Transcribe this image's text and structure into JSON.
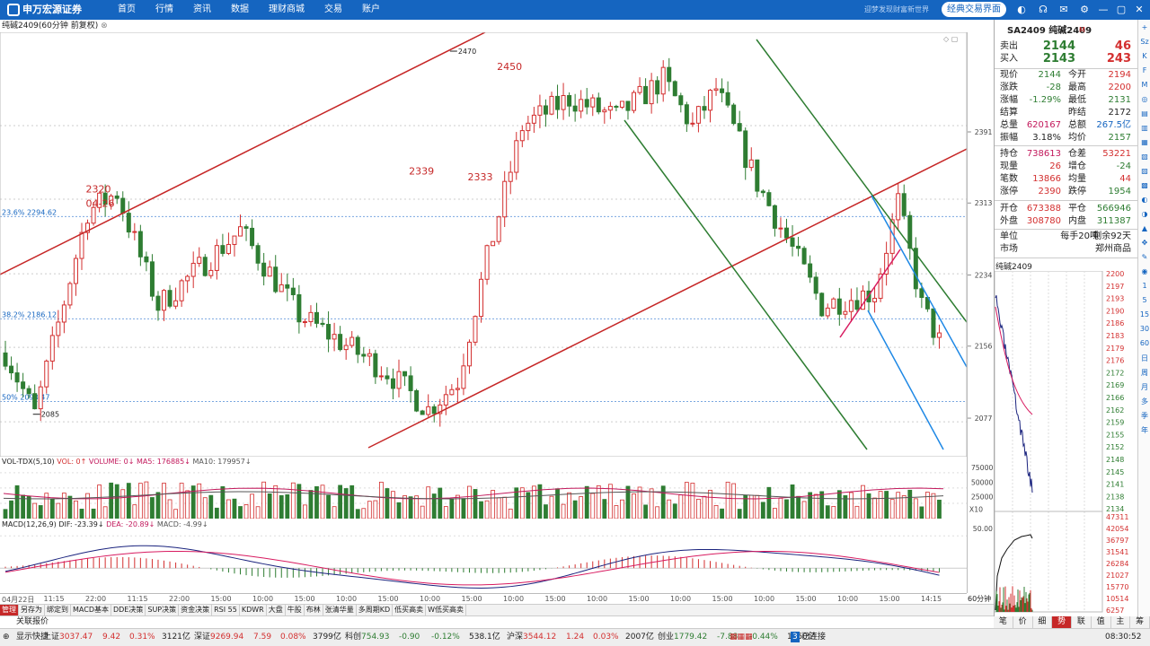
{
  "brand": {
    "name": "申万宏源证券",
    "sub": "SHENWAN HONGYUAN SECURITIES"
  },
  "nav": [
    "首页",
    "行情",
    "资讯",
    "数据",
    "理财商城",
    "交易",
    "账户"
  ],
  "slogan": "迎梦发现财富新世界",
  "classic_button": "经典交易界面",
  "chart_title": "纯碱2409(60分钟 前复权)",
  "main": {
    "ymin": 2040,
    "ymax": 2490,
    "ticks": [
      2391,
      2313,
      2234,
      2156,
      2077
    ],
    "fib": [
      {
        "label": "23.6% 2294.62",
        "v": 2294.62
      },
      {
        "label": "38.2% 2186.12",
        "v": 2186.12
      },
      {
        "label": "50% 2098.47",
        "v": 2098.47
      }
    ],
    "annotations": [
      {
        "text": "2320",
        "v": 2320,
        "t": 14,
        "type": "label"
      },
      {
        "text": "04-26",
        "v": 2305,
        "t": 14,
        "type": "label"
      },
      {
        "text": "2339",
        "v": 2339,
        "t": 69,
        "type": "label"
      },
      {
        "text": "2333",
        "v": 2333,
        "t": 79,
        "type": "label"
      },
      {
        "text": "2450",
        "v": 2450,
        "t": 84,
        "type": "label"
      },
      {
        "text": "2470",
        "v": 2470,
        "t": 76,
        "type": "marker"
      },
      {
        "text": "2085",
        "v": 2085,
        "t": 5,
        "type": "marker"
      }
    ]
  },
  "volume": {
    "header": {
      "name": "VOL-TDX(5,10)",
      "vol": "VOL: 0↑",
      "volume": "VOLUME: 0↓",
      "ma5": "MA5: 176885↓",
      "ma10": "MA10: 179957↓"
    },
    "ticks": [
      {
        "label": "75000",
        "v": 75000
      },
      {
        "label": "50000",
        "v": 50000
      },
      {
        "label": "25000",
        "v": 25000
      }
    ],
    "unit": "X10",
    "max": 85000
  },
  "macd": {
    "header": {
      "name": "MACD(12,26,9)",
      "dif": "DIF: -23.39↓",
      "dea": "DEA: -20.89↓",
      "macd": "MACD: -4.99↓"
    },
    "ticks": [
      {
        "label": "50.00",
        "v": 50
      }
    ],
    "max": 60,
    "min": -40
  },
  "xaxis": [
    "04月22日",
    "11:15",
    "22:00",
    "11:15",
    "22:00",
    "15:00",
    "10:00",
    "15:00",
    "10:00",
    "15:00",
    "10:00",
    "15:00",
    "10:00",
    "15:00",
    "10:00",
    "15:00",
    "10:00",
    "15:00",
    "10:00",
    "15:00",
    "10:00",
    "15:00",
    "14:15"
  ],
  "period": "60分钟",
  "bottom_tabs": [
    "管理",
    "另存为",
    "绑定到",
    "MACD基本",
    "DDE决策",
    "SUP决策",
    "资金决策",
    "RSI 55",
    "KDWR",
    "大盘",
    "牛股",
    "布林",
    "张清华量",
    "多周期KD",
    "低买高卖",
    "W低买高卖"
  ],
  "quote_tab": "关联报价",
  "status": {
    "items": [
      {
        "text": "显示快捷",
        "c": ""
      },
      {
        "text": "上证",
        "c": ""
      },
      {
        "text": "3037.47",
        "c": "up"
      },
      {
        "text": "9.42",
        "c": "up"
      },
      {
        "text": "0.31%",
        "c": "up"
      },
      {
        "text": "3121亿",
        "c": ""
      },
      {
        "text": "深证",
        "c": ""
      },
      {
        "text": "9269.94",
        "c": "up"
      },
      {
        "text": "7.59",
        "c": "up"
      },
      {
        "text": "0.08%",
        "c": "up"
      },
      {
        "text": "3799亿",
        "c": ""
      },
      {
        "text": "科创",
        "c": ""
      },
      {
        "text": "754.93",
        "c": "dn"
      },
      {
        "text": "-0.90",
        "c": "dn"
      },
      {
        "text": "-0.12%",
        "c": "dn"
      },
      {
        "text": "538.1亿",
        "c": ""
      },
      {
        "text": "沪深",
        "c": ""
      },
      {
        "text": "3544.12",
        "c": "up"
      },
      {
        "text": "1.24",
        "c": "up"
      },
      {
        "text": "0.03%",
        "c": "up"
      },
      {
        "text": "2007亿",
        "c": ""
      },
      {
        "text": "创业",
        "c": ""
      },
      {
        "text": "1779.42",
        "c": "dn"
      },
      {
        "text": "-7.88",
        "c": "dn"
      },
      {
        "text": "-0.44%",
        "c": "dn"
      },
      {
        "text": "1750亿",
        "c": ""
      }
    ],
    "connected": "已连接",
    "connected_count": "3",
    "time": "08:30:52"
  },
  "panel": {
    "code": "SA2409 纯碱2409",
    "badge": "M",
    "sell": {
      "label": "卖出",
      "price": "2144",
      "qty": "46"
    },
    "buy": {
      "label": "买入",
      "price": "2143",
      "qty": "243"
    },
    "rows": [
      {
        "l": "现价",
        "v": "2144",
        "vc": "dn",
        "l2": "今开",
        "v2": "2194",
        "v2c": "up"
      },
      {
        "l": "涨跌",
        "v": "-28",
        "vc": "dn",
        "l2": "最高",
        "v2": "2200",
        "v2c": "up"
      },
      {
        "l": "涨幅",
        "v": "-1.29%",
        "vc": "dn",
        "l2": "最低",
        "v2": "2131",
        "v2c": "dn"
      },
      {
        "l": "结算",
        "v": "",
        "vc": "",
        "l2": "昨结",
        "v2": "2172",
        "v2c": ""
      },
      {
        "l": "总量",
        "v": "620167",
        "vc": "pk",
        "l2": "总额",
        "v2": "267.5亿",
        "v2c": "bl"
      },
      {
        "l": "振幅",
        "v": "3.18%",
        "vc": "",
        "l2": "均价",
        "v2": "2157",
        "v2c": "dn"
      },
      {
        "l": "持仓",
        "v": "738613",
        "vc": "pk",
        "l2": "仓差",
        "v2": "53221",
        "v2c": "up"
      },
      {
        "l": "现量",
        "v": "26",
        "vc": "up",
        "l2": "增仓",
        "v2": "-24",
        "v2c": "dn"
      },
      {
        "l": "笔数",
        "v": "13866",
        "vc": "up",
        "l2": "均量",
        "v2": "44",
        "v2c": "up"
      },
      {
        "l": "涨停",
        "v": "2390",
        "vc": "up",
        "l2": "跌停",
        "v2": "1954",
        "v2c": "dn"
      },
      {
        "l": "开仓",
        "v": "673388",
        "vc": "up",
        "l2": "平仓",
        "v2": "566946",
        "v2c": "dn"
      },
      {
        "l": "外盘",
        "v": "308780",
        "vc": "up",
        "l2": "内盘",
        "v2": "311387",
        "v2c": "dn"
      }
    ],
    "unit": {
      "l": "单位",
      "v": "每手20吨",
      "v2": "剩余92天"
    },
    "market": {
      "l": "市场",
      "v": "郑州商品"
    },
    "mini_title": "纯碱2409",
    "mini_ticks": [
      "2200",
      "2197",
      "2193",
      "2190",
      "2186",
      "2183",
      "2179",
      "2176",
      "2172",
      "2169",
      "2166",
      "2162",
      "2159",
      "2155",
      "2152",
      "2148",
      "2145",
      "2141",
      "2138",
      "2134"
    ],
    "mini_vol_ticks": [
      "47311",
      "42054",
      "36797",
      "31541",
      "26284",
      "21027",
      "15770",
      "10514",
      "6257"
    ],
    "tabs": [
      "笔",
      "价",
      "细",
      "势",
      "联",
      "值",
      "主",
      "筹"
    ],
    "active_tab": "势"
  },
  "side_icons": [
    "+",
    "Sz",
    "K",
    "F",
    "M",
    "◎",
    "▤",
    "▥",
    "▦",
    "▧",
    "▨",
    "▩",
    "◐",
    "◑",
    "▲",
    "✥",
    "✎",
    "◉",
    "1",
    "5",
    "15",
    "30",
    "60",
    "日",
    "周",
    "月",
    "多",
    "季",
    "年"
  ]
}
